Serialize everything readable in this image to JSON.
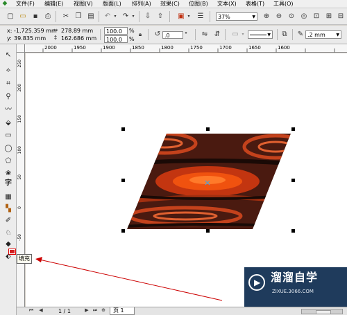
{
  "menu": [
    "文件(F)",
    "编辑(E)",
    "视图(V)",
    "版面(L)",
    "排列(A)",
    "效果(C)",
    "位图(B)",
    "文本(X)",
    "表格(T)",
    "工具(O)"
  ],
  "toolbar": {
    "zoom": "37%"
  },
  "property_bar": {
    "x_label": "x:",
    "x_value": "-1,725.359 mm",
    "y_label": "y:",
    "y_value": "39.835 mm",
    "width_value": "278.89 mm",
    "height_value": "162.686 mm",
    "scale_x": "100.0",
    "scale_y": "100.0",
    "percent": "%",
    "rotation": ".0",
    "degree": "°",
    "outline_width": ".2 mm"
  },
  "ruler": {
    "h_ticks": [
      "2000",
      "1950",
      "1900",
      "1850",
      "1800",
      "1750",
      "1700",
      "1650",
      "1600"
    ],
    "v_ticks": [
      "250",
      "200",
      "150",
      "100",
      "50",
      "0",
      "-50"
    ]
  },
  "tooltip": {
    "text": "填充"
  },
  "page_nav": {
    "counter": "1 / 1",
    "page_tab": "页 1"
  },
  "watermark": {
    "brand": "溜溜自学",
    "url": "ZIXUE.3066.COM"
  },
  "colors": {
    "annotation_red": "#cc0000",
    "watermark_bg": "#1f3b5c"
  }
}
